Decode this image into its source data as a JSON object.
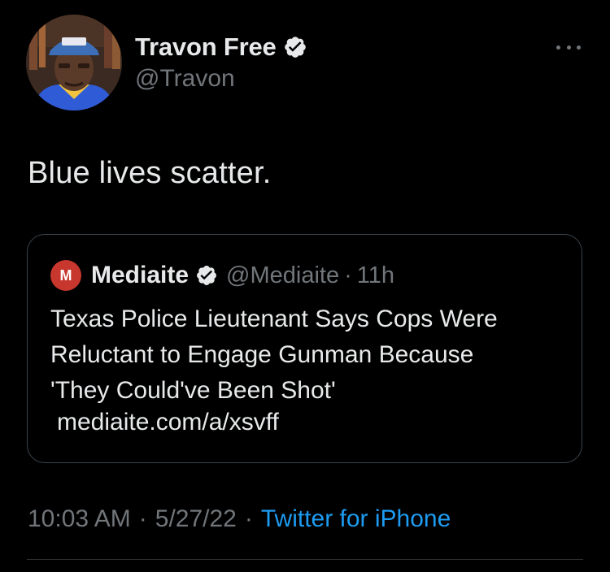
{
  "author": {
    "display_name": "Travon Free",
    "handle": "@Travon",
    "verified": true,
    "avatar_icon": "profile-photo"
  },
  "tweet": {
    "text": "Blue lives scatter."
  },
  "quoted_tweet": {
    "avatar_letter": "M",
    "display_name": "Mediaite",
    "verified": true,
    "handle": "@Mediaite",
    "separator": "·",
    "time_ago": "11h",
    "body_lines": [
      "Texas Police Lieutenant Says Cops Were",
      "Reluctant to Engage Gunman Because",
      "'They Could've Been Shot'"
    ],
    "link": "mediaite.com/a/xsvff"
  },
  "meta": {
    "time": "10:03 AM",
    "separator": "·",
    "date": "5/27/22",
    "source": "Twitter for iPhone"
  },
  "colors": {
    "background": "#000000",
    "primary_text": "#e7e9ea",
    "secondary_text": "#71767b",
    "accent": "#1d9bf0",
    "border": "#38444d",
    "mediaite_red": "#c8372d"
  },
  "icons": {
    "verified": "verified-badge-icon",
    "more": "more-options-icon"
  }
}
